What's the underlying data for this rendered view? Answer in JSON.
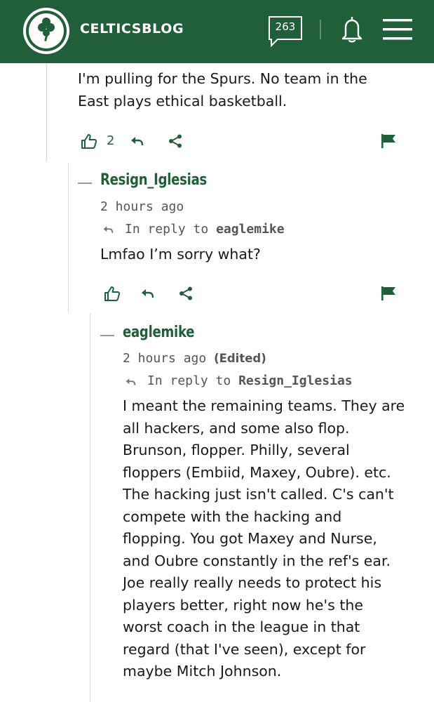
{
  "header": {
    "brand": "CELTICSBLOG",
    "comment_count": "263",
    "colors": {
      "brand_green": "#205f39",
      "text_white": "#ffffff"
    }
  },
  "comments": [
    {
      "body": "I'm pulling for the Spurs. No team in the East plays ethical basketball.",
      "likes": "2"
    },
    {
      "username": "Resign_Iglesias",
      "time": "2 hours ago",
      "reply_prefix": "In reply to",
      "reply_to": "eaglemike",
      "body": "Lmfao I’m sorry what?"
    },
    {
      "username": "eaglemike",
      "time": "2 hours ago",
      "edited": "(Edited)",
      "reply_prefix": "In reply to",
      "reply_to": "Resign_Iglesias",
      "body": "I meant the remaining teams. They are all hackers, and some also flop. Brunson, flopper. Philly, several floppers (Embiid, Maxey, Oubre). etc. The hacking just isn't called. C's can't compete with the hacking and flopping. You got Maxey and Nurse, and Oubre constantly in the ref's ear. Joe really really needs to protect his players better, right now he's the worst coach in the league in that regard (that I've seen), except for maybe Mitch Johnson."
    }
  ],
  "icons": [
    "clover-logo-icon",
    "comment-bubble-icon",
    "bell-icon",
    "hamburger-menu-icon",
    "thumbs-up-icon",
    "reply-arrow-icon",
    "share-icon",
    "flag-icon"
  ]
}
